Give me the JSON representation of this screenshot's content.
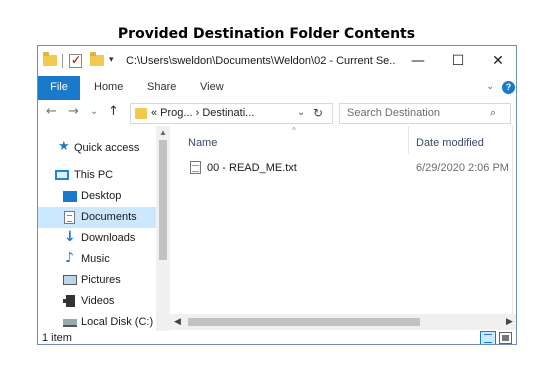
{
  "caption": "Provided Destination Folder Contents",
  "window": {
    "title": "C:\\Users\\sweldon\\Documents\\Weldon\\02 - Current Se...",
    "controls": {
      "minimize": "—",
      "maximize": "☐",
      "close": "✕"
    }
  },
  "ribbon": {
    "tabs": [
      {
        "label": "File"
      },
      {
        "label": "Home"
      },
      {
        "label": "Share"
      },
      {
        "label": "View"
      }
    ],
    "expand_glyph": "⌄",
    "help_glyph": "?"
  },
  "nav": {
    "back": "←",
    "forward": "→",
    "recent": "⌄",
    "up": "↑",
    "address": "« Prog... › Destinati...",
    "address_dropdown": "⌄",
    "refresh": "↻",
    "search_placeholder": "Search Destination",
    "search_glyph": "⌕"
  },
  "sidebar": {
    "items": [
      {
        "label": "Quick access",
        "icon": "star-icon"
      },
      {
        "label": "This PC",
        "icon": "computer-icon"
      },
      {
        "label": "Desktop",
        "icon": "desktop-icon"
      },
      {
        "label": "Documents",
        "icon": "documents-icon",
        "selected": true
      },
      {
        "label": "Downloads",
        "icon": "download-icon"
      },
      {
        "label": "Music",
        "icon": "music-icon"
      },
      {
        "label": "Pictures",
        "icon": "pictures-icon"
      },
      {
        "label": "Videos",
        "icon": "videos-icon"
      },
      {
        "label": "Local Disk (C:)",
        "icon": "disk-icon"
      }
    ]
  },
  "content": {
    "columns": {
      "name": "Name",
      "date_modified": "Date modified"
    },
    "sort_glyph": "^",
    "files": [
      {
        "name": "00 - READ_ME.txt",
        "date_modified": "6/29/2020 2:06 PM"
      }
    ]
  },
  "status": {
    "item_count": "1 item"
  },
  "colors": {
    "accent": "#1979ca",
    "selected": "#cce8ff",
    "folder": "#f2c94c"
  }
}
